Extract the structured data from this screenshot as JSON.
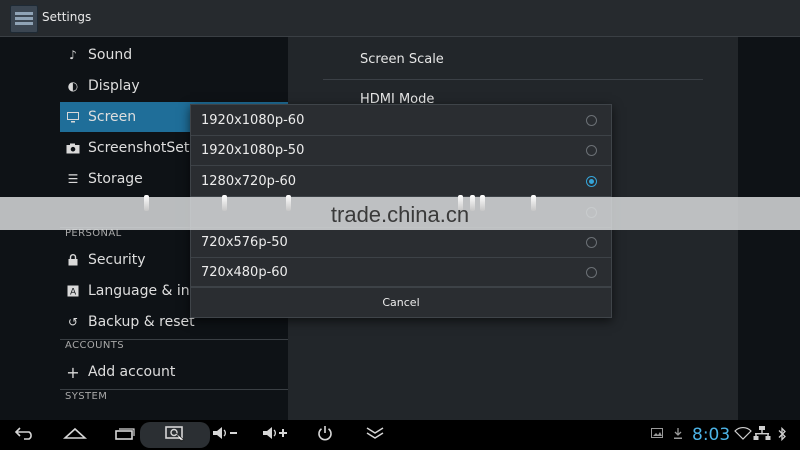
{
  "app": {
    "title": "Settings"
  },
  "sidebar": {
    "items_top": [
      {
        "label": "Sound",
        "icon": "speaker-icon"
      },
      {
        "label": "Display",
        "icon": "display-icon"
      },
      {
        "label": "Screen",
        "icon": "monitor-icon",
        "active": true
      },
      {
        "label": "ScreenshotSetti",
        "icon": "camera-icon"
      },
      {
        "label": "Storage",
        "icon": "storage-icon"
      }
    ],
    "section_personal": "PERSONAL",
    "items_personal": [
      {
        "label": "Security",
        "icon": "lock-icon"
      },
      {
        "label": "Language & inpu",
        "icon": "language-icon"
      },
      {
        "label": "Backup & reset",
        "icon": "backup-icon"
      }
    ],
    "section_accounts": "ACCOUNTS",
    "items_accounts": [
      {
        "label": "Add account",
        "icon": "plus-icon"
      }
    ],
    "section_system": "SYSTEM"
  },
  "content": {
    "items": [
      {
        "label": "Screen Scale"
      },
      {
        "label": "HDMI Mode"
      }
    ]
  },
  "dialog": {
    "options": [
      {
        "label": "1920x1080p-60",
        "selected": false
      },
      {
        "label": "1920x1080p-50",
        "selected": false
      },
      {
        "label": "1280x720p-60",
        "selected": true
      },
      {
        "label": "",
        "selected": false
      },
      {
        "label": "720x576p-50",
        "selected": false
      },
      {
        "label": "720x480p-60",
        "selected": false
      }
    ],
    "cancel_label": "Cancel"
  },
  "watermark": {
    "text": "trade.china.cn"
  },
  "navbar": {
    "buttons": [
      {
        "name": "back-button",
        "icon": "back-arrow-icon"
      },
      {
        "name": "home-button",
        "icon": "home-icon"
      },
      {
        "name": "recent-apps-button",
        "icon": "recent-apps-icon"
      },
      {
        "name": "screenshot-button",
        "icon": "screenshot-icon"
      },
      {
        "name": "volume-down-button",
        "icon": "volume-down-icon"
      },
      {
        "name": "volume-up-button",
        "icon": "volume-up-icon"
      },
      {
        "name": "power-button",
        "icon": "power-icon"
      },
      {
        "name": "menu-expand-button",
        "icon": "chevron-double-down-icon"
      }
    ],
    "clock": "8:03",
    "status_icons": [
      "image-icon",
      "download-icon",
      "wifi-icon",
      "ethernet-icon",
      "bluetooth-icon"
    ]
  },
  "colors": {
    "accent": "#1f6e99",
    "radio_selected": "#35a4d8",
    "clock": "#4cb3e6"
  }
}
